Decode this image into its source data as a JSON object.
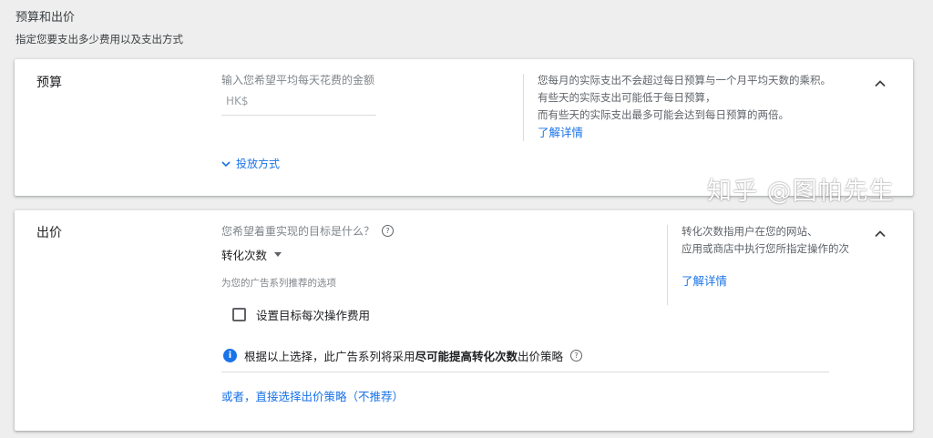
{
  "header": {
    "title": "预算和出价",
    "subtitle": "指定您要支出多少费用以及支出方式"
  },
  "budget": {
    "label": "预算",
    "prompt": "输入您希望平均每天花费的金额",
    "currency": "HK$",
    "delivery_link": "投放方式",
    "help_lines": [
      "您每月的实际支出不会超过每日预算与一个月平均天数的乘积。",
      "有些天的实际支出可能低于每日预算，",
      "而有些天的实际支出最多可能会达到每日预算的两倍。"
    ],
    "learn_more": "了解详情"
  },
  "bidding": {
    "label": "出价",
    "goal_question": "您希望着重实现的目标是什么？",
    "goal_selected": "转化次数",
    "recommended_note": "为您的广告系列推荐的选项",
    "target_cpa_label": "设置目标每次操作费用",
    "target_cpa_checked": false,
    "info_prefix": "根据以上选择，此广告系列将采用",
    "info_strategy": "尽可能提高转化次数",
    "info_suffix": "出价策略",
    "manual_link": "或者，直接选择出价策略（不推荐）",
    "help_lines": [
      "转化次数指用户在您的网站、",
      "应用或商店中执行您所指定操作的次"
    ],
    "learn_more": "了解详情"
  },
  "watermark": "知乎 @图帕先生",
  "icons": {
    "collapse": "chevron-up-icon",
    "expand": "chevron-down-icon",
    "help": "help-circle-icon",
    "info": "info-icon",
    "dropdown": "dropdown-caret-icon"
  },
  "colors": {
    "link": "#1a73e8",
    "info_icon": "#1a73e8",
    "background": "#eeeeee"
  }
}
